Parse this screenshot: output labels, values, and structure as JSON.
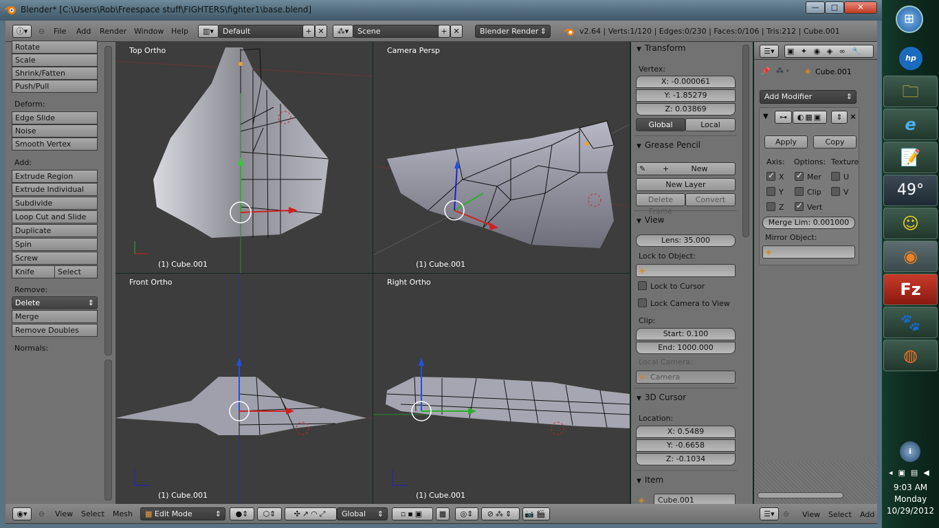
{
  "window": {
    "title": "Blender* [C:\\Users\\Rob\\Freespace stuff\\FIGHTERS\\fighter1\\base.blend]",
    "minimize": "—",
    "maximize": "□",
    "close": "✕"
  },
  "topbar": {
    "menus": [
      "File",
      "Add",
      "Render",
      "Window",
      "Help"
    ],
    "screen": "Default",
    "scene": "Scene",
    "engine": "Blender Render",
    "stats": "v2.64 | Verts:1/120 | Edges:0/230 | Faces:0/106 | Tris:212 | Cube.001"
  },
  "toolshelf": {
    "transform": [
      "Rotate",
      "Scale",
      "Shrink/Fatten",
      "Push/Pull"
    ],
    "deform_label": "Deform:",
    "deform": [
      "Edge Slide",
      "Noise",
      "Smooth Vertex"
    ],
    "add_label": "Add:",
    "add": [
      "Extrude Region",
      "Extrude Individual",
      "Subdivide",
      "Loop Cut and Slide",
      "Duplicate",
      "Spin",
      "Screw"
    ],
    "knife": "Knife",
    "select": "Select",
    "remove_label": "Remove:",
    "delete": "Delete",
    "remove": [
      "Merge",
      "Remove Doubles"
    ],
    "normals_label": "Normals:"
  },
  "viewports": [
    {
      "name": "Top Ortho",
      "object": "(1) Cube.001"
    },
    {
      "name": "Camera Persp",
      "object": "(1) Cube.001"
    },
    {
      "name": "Front Ortho",
      "object": "(1) Cube.001"
    },
    {
      "name": "Right Ortho",
      "object": "(1) Cube.001"
    }
  ],
  "npanel": {
    "transform": {
      "title": "Transform",
      "vertex_label": "Vertex:",
      "x": "X: -0.000061",
      "y": "Y: -1.85279",
      "z": "Z: 0.03869",
      "global": "Global",
      "local": "Local"
    },
    "grease": {
      "title": "Grease Pencil",
      "new": "New",
      "new_layer": "New Layer",
      "delete_frame": "Delete Frame",
      "convert": "Convert"
    },
    "view": {
      "title": "View",
      "lens": "Lens: 35.000",
      "lock_obj": "Lock to Object:",
      "lock_cursor": "Lock to Cursor",
      "lock_camera": "Lock Camera to View",
      "clip": "Clip:",
      "start": "Start: 0.100",
      "end": "End: 1000.000",
      "local_camera": "Local Camera:",
      "camera": "Camera"
    },
    "cursor": {
      "title": "3D Cursor",
      "location": "Location:",
      "x": "X: 0.5489",
      "y": "Y: -0.6658",
      "z": "Z: -0.1034"
    },
    "item": {
      "title": "Item",
      "name": "Cube.001"
    }
  },
  "props": {
    "object": "Cube.001",
    "add_modifier": "Add Modifier",
    "apply": "Apply",
    "copy": "Copy",
    "axis": "Axis:",
    "options": "Options:",
    "texture": "Texture",
    "x": "X",
    "y": "Y",
    "z": "Z",
    "mer": "Mer",
    "clip": "Clip",
    "vert": "Vert",
    "u": "U",
    "v": "V",
    "merge_lim": "Merge Lim: 0.001000",
    "mirror_object": "Mirror Object:"
  },
  "bottombar": {
    "menus": [
      "View",
      "Select",
      "Mesh"
    ],
    "mode": "Edit Mode",
    "orientation": "Global"
  },
  "bottombar2": {
    "menus": [
      "View",
      "Select",
      "Add"
    ]
  },
  "taskbar": {
    "temp": "49°",
    "time": "9:03 AM",
    "day": "Monday",
    "date": "10/29/2012"
  }
}
